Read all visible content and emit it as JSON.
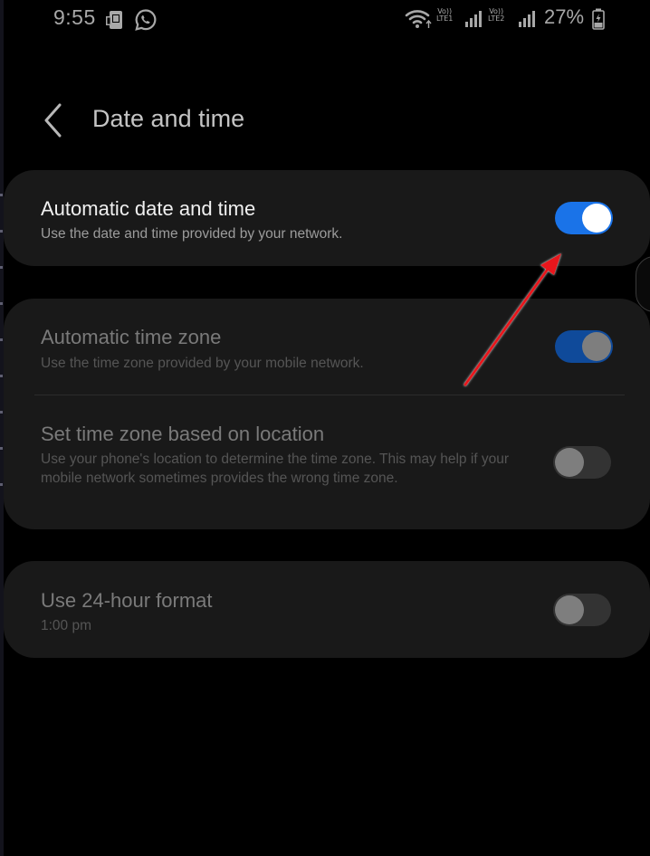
{
  "status_bar": {
    "time": "9:55",
    "battery_percent": "27%",
    "sim1_label_top": "Vo))",
    "sim1_label_bottom": "LTE1",
    "sim2_label_top": "Vo))",
    "sim2_label_bottom": "LTE2",
    "icons": [
      "screenshot-notification-icon",
      "whatsapp-icon",
      "wifi-icon",
      "signal-icon",
      "signal-icon",
      "battery-charging-icon"
    ]
  },
  "header": {
    "back_icon": "chevron-left-icon",
    "title": "Date and time"
  },
  "settings": {
    "auto_date_time": {
      "title": "Automatic date and time",
      "subtitle": "Use the date and time provided by your network.",
      "enabled": true
    },
    "auto_time_zone": {
      "title": "Automatic time zone",
      "subtitle": "Use the time zone provided by your mobile network.",
      "enabled": true,
      "disabled_state": true
    },
    "location_time_zone": {
      "title": "Set time zone based on location",
      "subtitle": "Use your phone's location to determine the time zone. This may help if your mobile network sometimes provides the wrong time zone.",
      "enabled": false,
      "disabled_state": true
    },
    "format_24h": {
      "title": "Use 24-hour format",
      "subtitle": "1:00 pm",
      "enabled": false,
      "disabled_state": true
    }
  },
  "colors": {
    "background": "#000000",
    "card": "#191919",
    "toggle_on": "#1a73e8",
    "toggle_on_dimmed": "#0f4a9a",
    "annotation_arrow": "#e8141c"
  }
}
